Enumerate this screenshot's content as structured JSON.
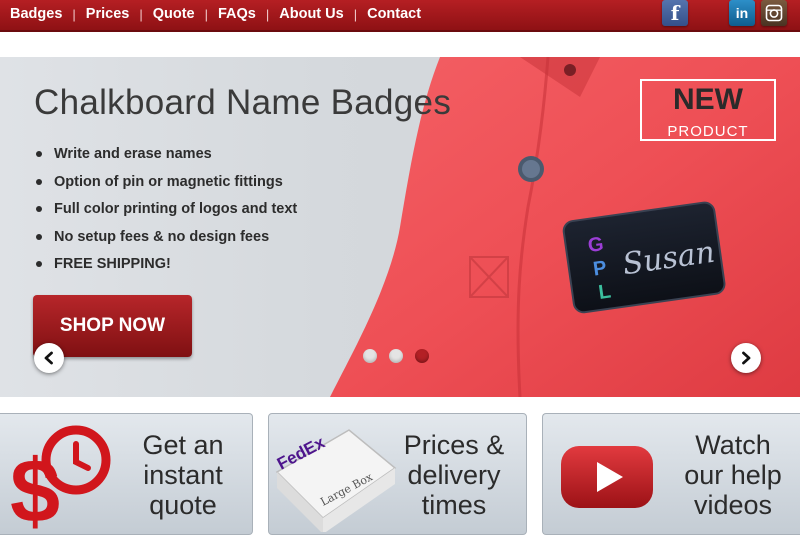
{
  "nav": {
    "items": [
      "Badges",
      "Prices",
      "Quote",
      "FAQs",
      "About Us",
      "Contact"
    ],
    "separator": "|"
  },
  "social": {
    "facebook": "f",
    "linkedin": "in"
  },
  "hero": {
    "title": "Chalkboard Name Badges",
    "bullets": [
      "Write and erase names",
      "Option of pin or magnetic fittings",
      "Full color printing of logos and text",
      "No setup fees & no design fees",
      "FREE SHIPPING!"
    ],
    "cta": "SHOP NOW",
    "badge_new": "NEW",
    "badge_product": "PRODUCT",
    "badge_name": "Susan",
    "badge_logo": "GPL",
    "slides_total": 3,
    "slide_active": 3
  },
  "panels": [
    {
      "line1": "Get an",
      "line2": "instant",
      "line3": "quote",
      "icon": "dollar-clock-icon"
    },
    {
      "line1": "Prices &",
      "line2": "delivery",
      "line3": "times",
      "icon": "fedex-box-icon",
      "box_brand": "FedEx",
      "box_label": "Large Box"
    },
    {
      "line1": "Watch",
      "line2": "our help",
      "line3": "videos",
      "icon": "play-video-icon"
    }
  ],
  "colors": {
    "brand_red": "#a3181c",
    "panel_bg": "#d3dae1"
  }
}
